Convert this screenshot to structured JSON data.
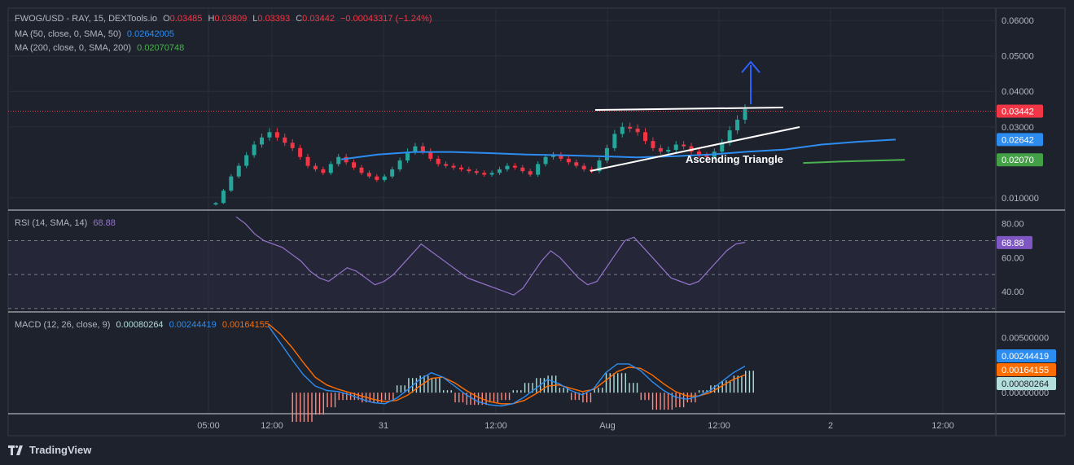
{
  "header": {
    "symbol": "FWOG/USD - RAY, 15, DEXTools.io",
    "o_label": "O",
    "o": "0.03485",
    "h_label": "H",
    "h": "0.03809",
    "l_label": "L",
    "l": "0.03393",
    "c_label": "C",
    "c": "0.03442",
    "change": "−0.00043317 (−1.24%)"
  },
  "ma50": {
    "label": "MA (50, close, 0, SMA, 50)",
    "value": "0.02642005"
  },
  "ma200": {
    "label": "MA (200, close, 0, SMA, 200)",
    "value": "0.02070748"
  },
  "rsi": {
    "label": "RSI (14, SMA, 14)",
    "value": "68.88"
  },
  "macd": {
    "label": "MACD (12, 26, close, 9)",
    "hist": "0.00080264",
    "macd": "0.00244419",
    "signal": "0.00164155"
  },
  "annotation": "Ascending Triangle",
  "brand": "TradingView",
  "colors": {
    "bg": "#1e222d",
    "up": "#26a69a",
    "down": "#f23645",
    "ma50": "#2d8cf0",
    "ma200": "#4caf50",
    "rsi": "#9575cd",
    "macd": "#2d8cf0",
    "signal": "#ff6d00"
  },
  "chart_data": [
    {
      "type": "candlestick",
      "title": "FWOG/USD - RAY, 15, DEXTools.io",
      "y_ticks": [
        "0.06000",
        "0.05000",
        "0.04000",
        "0.03000",
        "0.010000"
      ],
      "ylim": [
        0.0065,
        0.0635
      ],
      "x_ticks": [
        "05:00",
        "12:00",
        "31",
        "12:00",
        "Aug",
        "12:00",
        "2",
        "12:00"
      ],
      "price_labels": {
        "last": "0.03442",
        "ma50": "0.02642",
        "ma200": "0.02070"
      },
      "series": [
        {
          "name": "MA (50, close, 0, SMA, 50)",
          "x": [
            0.36,
            0.4,
            0.44,
            0.48,
            0.52,
            0.56,
            0.6,
            0.64,
            0.68,
            0.72,
            0.76,
            0.8,
            0.84,
            0.88,
            0.92,
            0.96
          ],
          "values": [
            0.0208,
            0.0222,
            0.0229,
            0.0229,
            0.0226,
            0.0222,
            0.022,
            0.0217,
            0.0214,
            0.0217,
            0.0222,
            0.023,
            0.0236,
            0.025,
            0.0258,
            0.0264
          ]
        },
        {
          "name": "MA (200, close, 0, SMA, 200)",
          "x": [
            0.86,
            0.9,
            0.94,
            0.97
          ],
          "values": [
            0.0198,
            0.0202,
            0.0205,
            0.0207
          ]
        }
      ],
      "close": [
        0.0085,
        0.012,
        0.016,
        0.019,
        0.022,
        0.025,
        0.027,
        0.0285,
        0.027,
        0.0255,
        0.024,
        0.0215,
        0.019,
        0.018,
        0.017,
        0.0195,
        0.0215,
        0.02,
        0.0185,
        0.017,
        0.016,
        0.015,
        0.016,
        0.018,
        0.0205,
        0.023,
        0.0245,
        0.023,
        0.021,
        0.0195,
        0.019,
        0.0185,
        0.018,
        0.0175,
        0.017,
        0.0165,
        0.017,
        0.018,
        0.019,
        0.0185,
        0.0175,
        0.0165,
        0.0195,
        0.0215,
        0.022,
        0.021,
        0.02,
        0.019,
        0.018,
        0.0175,
        0.0205,
        0.024,
        0.028,
        0.03,
        0.0295,
        0.0285,
        0.026,
        0.024,
        0.023,
        0.0235,
        0.025,
        0.0245,
        0.023,
        0.022,
        0.0215,
        0.023,
        0.0255,
        0.029,
        0.032,
        0.035
      ]
    },
    {
      "type": "line",
      "title": "RSI (14, SMA, 14)",
      "y_ticks": [
        "80.00",
        "60.00",
        "40.00"
      ],
      "ylim": [
        28,
        88
      ],
      "bands": [
        30,
        50,
        70
      ],
      "price_label": "68.88",
      "series": [
        {
          "name": "RSI (14, SMA, 14)",
          "values": [
            84,
            80,
            74,
            70,
            68,
            66,
            62,
            58,
            52,
            48,
            46,
            50,
            54,
            52,
            48,
            44,
            46,
            50,
            56,
            62,
            68,
            64,
            60,
            56,
            52,
            48,
            46,
            44,
            42,
            40,
            38,
            42,
            50,
            58,
            64,
            60,
            54,
            48,
            44,
            46,
            54,
            62,
            70,
            72,
            66,
            60,
            54,
            48,
            46,
            44,
            46,
            52,
            58,
            64,
            68,
            69
          ]
        }
      ]
    },
    {
      "type": "line",
      "title": "MACD (12, 26, close, 9)",
      "y_ticks": [
        "0.00500000",
        "0.00000000"
      ],
      "ylim": [
        -0.0019,
        0.0073
      ],
      "price_labels": {
        "macd": "0.00244419",
        "signal": "0.00164155",
        "histogram": "0.00080264"
      },
      "series": [
        {
          "name": "MACD",
          "values": [
            0.006,
            0.0045,
            0.003,
            0.0016,
            0.0006,
            0.0002,
            0.0001,
            -0.0002,
            -0.0006,
            -0.0009,
            -0.001,
            -0.0005,
            0.0003,
            0.0012,
            0.0018,
            0.0014,
            0.0006,
            -0.0002,
            -0.0008,
            -0.0011,
            -0.0012,
            -0.001,
            -0.0004,
            0.0004,
            0.0012,
            0.0008,
            0.0002,
            -0.0002,
            0.0004,
            0.0018,
            0.0026,
            0.0026,
            0.002,
            0.001,
            0.0002,
            -0.0004,
            -0.0006,
            -0.0003,
            0.0002,
            0.001,
            0.0018,
            0.0024
          ]
        },
        {
          "name": "Signal",
          "values": [
            0.0062,
            0.0053,
            0.0041,
            0.0027,
            0.0014,
            0.0007,
            0.0003,
            0.0,
            -0.0003,
            -0.0006,
            -0.0008,
            -0.0007,
            -0.0002,
            0.0006,
            0.0013,
            0.0014,
            0.0009,
            0.0002,
            -0.0004,
            -0.0008,
            -0.001,
            -0.001,
            -0.0007,
            -0.0001,
            0.0006,
            0.0007,
            0.0004,
            0.0001,
            0.0003,
            0.0011,
            0.0019,
            0.0023,
            0.0022,
            0.0016,
            0.0008,
            0.0001,
            -0.0003,
            -0.0003,
            0.0,
            0.0006,
            0.0012,
            0.0016
          ]
        }
      ]
    }
  ]
}
